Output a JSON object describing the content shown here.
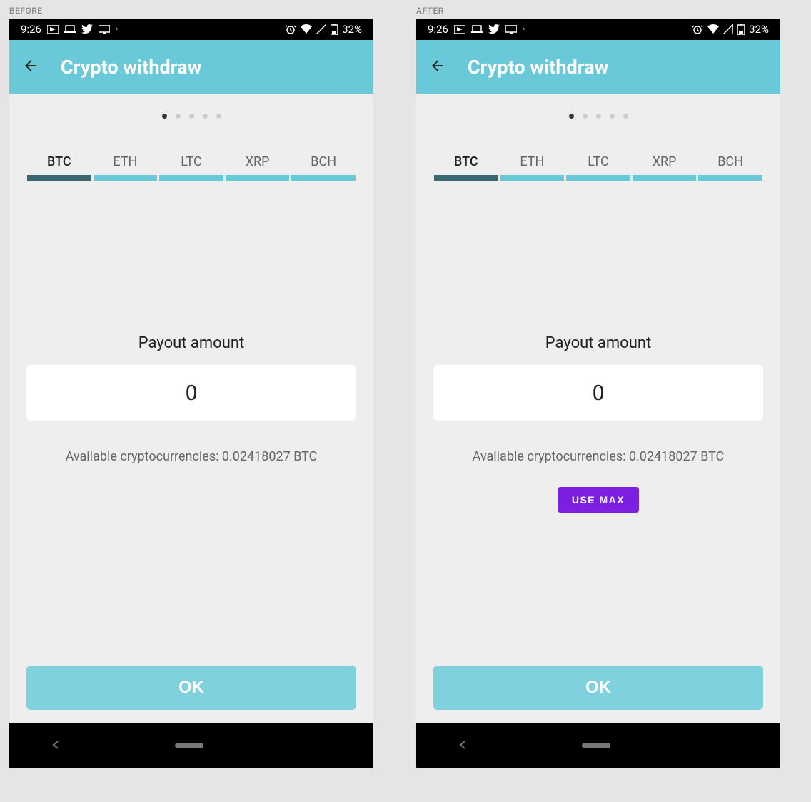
{
  "labels": {
    "before": "BEFORE",
    "after": "AFTER"
  },
  "statusBar": {
    "time": "9:26",
    "battery": "32%"
  },
  "header": {
    "title": "Crypto withdraw"
  },
  "tabs": [
    "BTC",
    "ETH",
    "LTC",
    "XRP",
    "BCH"
  ],
  "activeTab": 0,
  "activeDot": 0,
  "payout": {
    "label": "Payout amount",
    "value": "0",
    "available": "Available cryptocurrencies: 0.02418027 BTC"
  },
  "buttons": {
    "useMax": "USE MAX",
    "ok": "OK"
  }
}
